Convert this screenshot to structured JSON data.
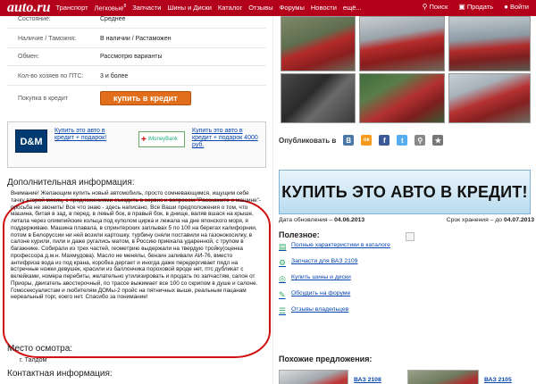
{
  "topbar": {
    "logo": "auto.ru",
    "nav": [
      "Транспорт",
      "Легковые",
      "Запчасти",
      "Шины и Диски",
      "Каталог",
      "Отзывы",
      "Форумы",
      "Новости",
      "ещё..."
    ],
    "nav_sup": "8",
    "search": "Поиск",
    "sell": "Продать",
    "login": "Войти",
    "accent": "#b3001b"
  },
  "specs": [
    {
      "key": "Состояние:",
      "value": "Среднее"
    },
    {
      "key": "Наличие / Таможня:",
      "value": "В наличии / Растаможен"
    },
    {
      "key": "Обмен:",
      "value": "Рассмотрю варианты"
    },
    {
      "key": "Кол-во хозяев по ПТС:",
      "value": "3 и более"
    },
    {
      "key": "Покупка в кредит",
      "value": "купить в кредит"
    }
  ],
  "ads": {
    "dm_logo": "D&M",
    "dm_link": "Купить это авто в кредит + подарок!",
    "imoney_logo": "iMoneyBank",
    "imoney_link": "Купить это авто в кредит + подарок 4000 руб."
  },
  "extra": {
    "title": "Дополнительная информация:",
    "text": "Внимание! Желающим купить новый автомобиль, просто сомневающимся, ищущим себе тачку второй месяц, с предложениями съездить в сервис и вопросом:\"Расскажите о машине\"-просьба не звонить! Все что знаю - здесь написано. Все Ваши предположения о том, что машина, битая в зад, в перед, в левый бок, в правый бок, в днище, валяв вшася на крыше, летала через олимпийские кольца под куполом цирка и лежала на дне японского моря, я поддерживаю. Машина плавала, в спринтерских заплывах 5 по 100 на берегах калифорнии, потом в Белоруссии ни ней возили картошку, турбину сняли поставили на газонокосилку, в салоне курили, пили и даже ругались матом, в Россию приехала ударенной, с трупом в багажнике. Собирали из трех частей, геометрию выдержали на твердую тройку(оценка профессора д.м.н. Махмудова). Масло не менялы, бензин заливали АИ-76, вместо антифриза вода из под крана, коробка дергает и иногда даже передергивает пядл на встречные ножки девушек, красили из баллончика пороховой вроде нет, птс дубликат с вклейками, номера перебиты, желательно утилизировать и продать по запчастям, салон от Приоры, двигатель авостерочный, по трассе выжимает все 100 со скрипом в душе и салоне. Гомосексуалистам и любителям ДОМы-2 пройс на пятничных выше, реальным пацанам нереальный торг, коего нет. Спасибо за понимание!"
  },
  "place": {
    "title": "Место осмотра:",
    "value": "г. Талдом"
  },
  "contact_title": "Контактная информация:",
  "share": {
    "label": "Опубликовать в",
    "networks": [
      {
        "name": "vkontakte-icon",
        "glyph": "В",
        "color": "#4a76a8"
      },
      {
        "name": "odnoklassniki-icon",
        "glyph": "ок",
        "color": "#f59a1b"
      },
      {
        "name": "facebook-icon",
        "glyph": "f",
        "color": "#3b5998"
      },
      {
        "name": "twitter-icon",
        "glyph": "t",
        "color": "#55acee"
      },
      {
        "name": "link-icon",
        "glyph": "⚲",
        "color": "#888"
      },
      {
        "name": "star-icon",
        "glyph": "★",
        "color": "#777"
      }
    ]
  },
  "banner": "КУПИТЬ ЭТО АВТО В КРЕДИТ!",
  "dates": {
    "updated_label": "Дата обновления –",
    "updated_value": "04.06.2013",
    "expires_label": "Срок хранения – до",
    "expires_value": "04.07.2013"
  },
  "useful": {
    "title": "Полезное:",
    "links": [
      "Полные характеристики в каталоге",
      "Запчасти для ВАЗ 2109",
      "Купить шины и диски",
      "Обсудить на форуме",
      "Отзывы владельцев"
    ]
  },
  "similar": {
    "title": "Похожие предложения:",
    "items": [
      "ВАЗ 2108",
      "ВАЗ 2105"
    ]
  }
}
